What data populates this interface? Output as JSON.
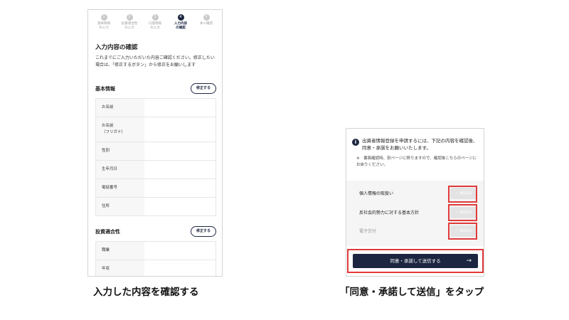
{
  "steps": [
    {
      "num": "1",
      "label": "基本情報\nの入力"
    },
    {
      "num": "2",
      "label": "投資適合性\nの入力"
    },
    {
      "num": "3",
      "label": "口座情報\nの入力"
    },
    {
      "num": "4",
      "label": "入力内容\nの確認"
    },
    {
      "num": "5",
      "label": "本人確認"
    }
  ],
  "confirm": {
    "title": "入力内容の確認",
    "description": "これまでにご入力いただいた内容ご確認ください。修正したい場合は、「修正するボタン」から修正をお願いします",
    "edit_label": "修正する",
    "basic": {
      "title": "基本情報",
      "rows": [
        "お名前",
        "お名前\n（フリガナ）",
        "性別",
        "生年月日",
        "電話番号",
        "住所"
      ]
    },
    "suitability": {
      "title": "投資適合性",
      "rows": [
        "職業",
        "年収"
      ]
    }
  },
  "consent": {
    "notice": "出資者情報登録を申請するには、下記の内容を確認後、同意・承諾をお願いいたします。",
    "sub_note": "※　書面確認時、別ページに移りますので、確認後こちらのページにお戻りください。",
    "items": [
      {
        "label": "個人情報の取扱い",
        "button": "確認済み"
      },
      {
        "label": "反社会的勢力に対する基本方針",
        "button": "確認済み"
      },
      {
        "label": "電子交付",
        "button": "確認済み"
      }
    ],
    "submit_label": "同意・承諾して送信する",
    "submit_arrow": "→"
  },
  "captions": {
    "left": "入力した内容を確認する",
    "right": "「同意・承諾して送信」をタップ"
  },
  "colors": {
    "navy": "#1c2640",
    "highlight": "#e23a3a"
  }
}
